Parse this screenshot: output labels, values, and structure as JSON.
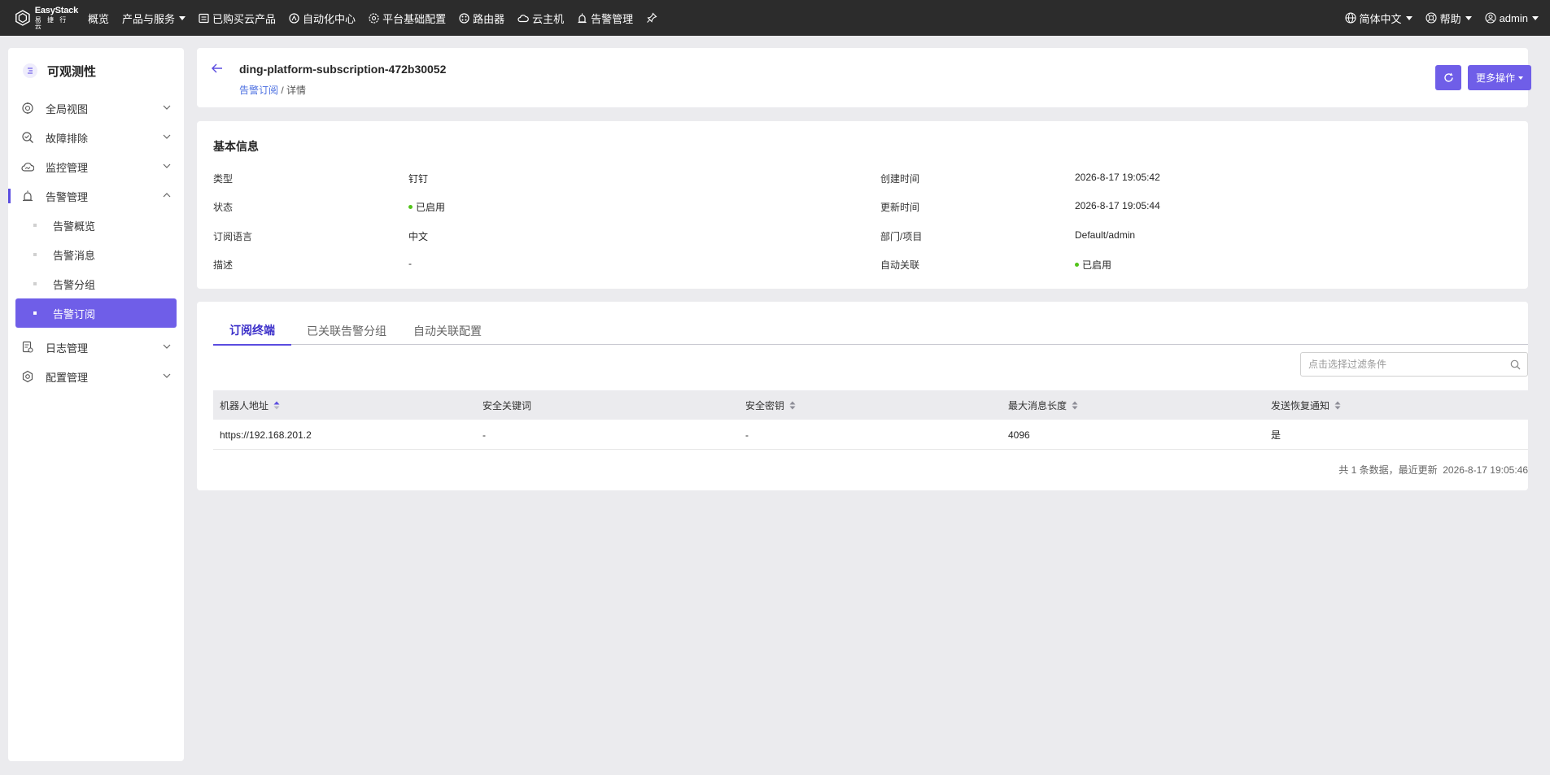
{
  "topbar": {
    "logo_top": "EasyStack",
    "logo_bottom": "易 捷 行 云",
    "nav": [
      {
        "label": "概览",
        "icon": "none"
      },
      {
        "label": "产品与服务",
        "icon": "dropdown"
      },
      {
        "label": "已购买云产品",
        "icon": "list-icon"
      },
      {
        "label": "自动化中心",
        "icon": "automation-icon"
      },
      {
        "label": "平台基础配置",
        "icon": "settings-icon"
      },
      {
        "label": "路由器",
        "icon": "router-icon"
      },
      {
        "label": "云主机",
        "icon": "cloud-icon"
      },
      {
        "label": "告警管理",
        "icon": "alarm-icon"
      }
    ],
    "language": "简体中文",
    "help": "帮助",
    "user": "admin"
  },
  "sidebar": {
    "title": "可观测性",
    "items": [
      {
        "label": "全局视图"
      },
      {
        "label": "故障排除"
      },
      {
        "label": "监控管理"
      },
      {
        "label": "告警管理"
      },
      {
        "label": "日志管理"
      },
      {
        "label": "配置管理"
      }
    ],
    "sub_items": [
      {
        "label": "告警概览"
      },
      {
        "label": "告警消息"
      },
      {
        "label": "告警分组"
      },
      {
        "label": "告警订阅"
      }
    ]
  },
  "header": {
    "title": "ding-platform-subscription-472b30052",
    "breadcrumb_link": "告警订阅",
    "breadcrumb_sep": " / ",
    "breadcrumb_current": "详情",
    "more_actions": "更多操作"
  },
  "info": {
    "title": "基本信息",
    "type_label": "类型",
    "type_value": "钉钉",
    "status_label": "状态",
    "status_value": "已启用",
    "lang_label": "订阅语言",
    "lang_value": "中文",
    "desc_label": "描述",
    "desc_value": "-",
    "created_label": "创建时间",
    "created_value": "2026-8-17 19:05:42",
    "updated_label": "更新时间",
    "updated_value": "2026-8-17 19:05:44",
    "dept_label": "部门/项目",
    "dept_value": "Default/admin",
    "auto_label": "自动关联",
    "auto_value": "已启用",
    "status_color": "#52c41a"
  },
  "tabs": [
    "订阅终端",
    "已关联告警分组",
    "自动关联配置"
  ],
  "filter": {
    "placeholder": "点击选择过滤条件"
  },
  "table": {
    "columns": [
      "机器人地址",
      "安全关键词",
      "安全密钥",
      "最大消息长度",
      "发送恢复通知"
    ],
    "rows": [
      [
        "https://192.168.201.2",
        "-",
        "-",
        "4096",
        "是"
      ]
    ]
  },
  "footer": {
    "text": "共 1 条数据，最近更新  2026-8-17 19:05:46"
  },
  "colors": {
    "accent": "#6f5ee8",
    "topbar": "#2c2c2c",
    "link": "#4a6ee0"
  }
}
